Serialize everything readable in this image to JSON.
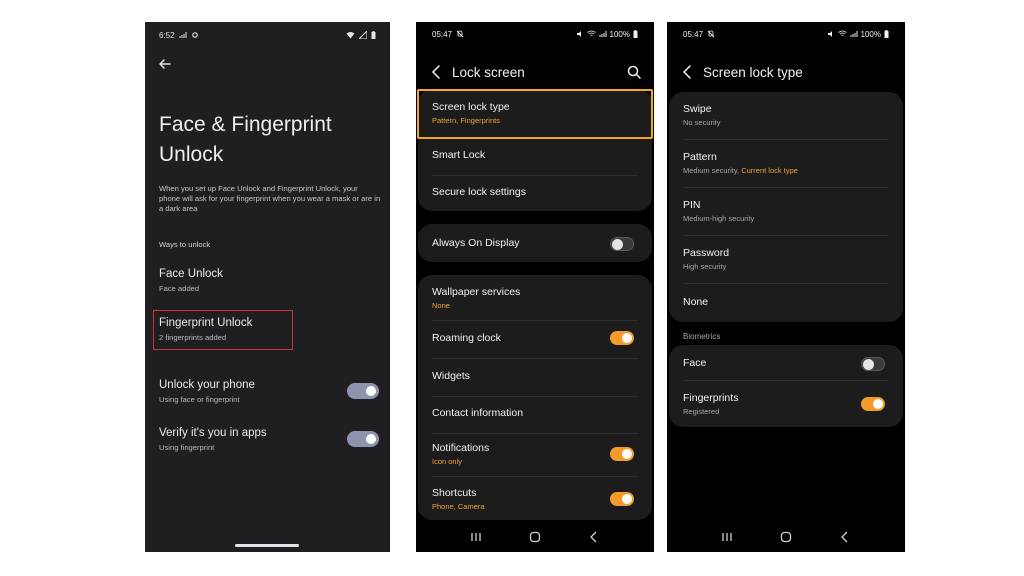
{
  "phone1": {
    "status_time": "6:52",
    "title": "Face & Fingerprint Unlock",
    "description": "When you set up Face Unlock and Fingerprint Unlock, your phone will ask for your fingerprint when you wear a mask or are in a dark area",
    "section": "Ways to unlock",
    "face_unlock": {
      "title": "Face Unlock",
      "subtitle": "Face added"
    },
    "fingerprint_unlock": {
      "title": "Fingerprint Unlock",
      "subtitle": "2 fingerprints added"
    },
    "unlock_phone": {
      "title": "Unlock your phone",
      "subtitle": "Using face or fingerprint",
      "enabled": true
    },
    "verify_apps": {
      "title": "Verify it's you in apps",
      "subtitle": "Using fingerprint",
      "enabled": true
    }
  },
  "phone2": {
    "status_time": "05:47",
    "battery": "100%",
    "title": "Lock screen",
    "items": {
      "screen_lock_type": {
        "title": "Screen lock type",
        "subtitle": "Pattern, Fingerprints"
      },
      "smart_lock": {
        "title": "Smart Lock"
      },
      "secure_lock": {
        "title": "Secure lock settings"
      },
      "always_on": {
        "title": "Always On Display",
        "enabled": false
      },
      "wallpaper": {
        "title": "Wallpaper services",
        "subtitle": "None"
      },
      "roaming_clock": {
        "title": "Roaming clock",
        "enabled": true
      },
      "widgets": {
        "title": "Widgets"
      },
      "contact": {
        "title": "Contact information"
      },
      "notifications": {
        "title": "Notifications",
        "subtitle": "Icon only",
        "enabled": true
      },
      "shortcuts": {
        "title": "Shortcuts",
        "subtitle": "Phone, Camera",
        "enabled": true
      }
    }
  },
  "phone3": {
    "status_time": "05:47",
    "battery": "100%",
    "title": "Screen lock type",
    "swipe": {
      "title": "Swipe",
      "subtitle": "No security"
    },
    "pattern": {
      "title": "Pattern",
      "subtitle": "Medium security, ",
      "current": "Current lock type"
    },
    "pin": {
      "title": "PIN",
      "subtitle": "Medium-high security"
    },
    "password": {
      "title": "Password",
      "subtitle": "High security"
    },
    "none": {
      "title": "None"
    },
    "biometrics_label": "Biometrics",
    "face": {
      "title": "Face",
      "enabled": false
    },
    "fingerprints": {
      "title": "Fingerprints",
      "subtitle": "Registered",
      "enabled": true
    }
  },
  "colors": {
    "accent_orange": "#f39c2c",
    "highlight_red": "#d0323a",
    "highlight_yellow": "#f5a623",
    "pixel_toggle": "#8d94ad"
  }
}
